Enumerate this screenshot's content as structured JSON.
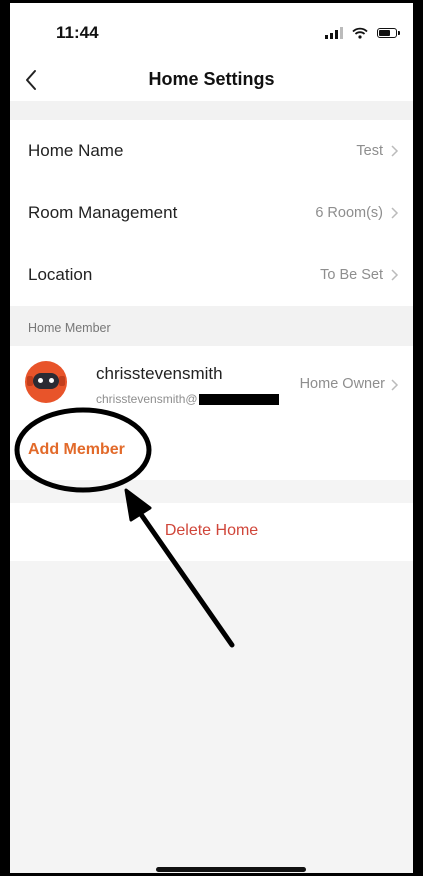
{
  "status_bar": {
    "time": "11:44"
  },
  "nav": {
    "title": "Home Settings"
  },
  "settings_rows": [
    {
      "label": "Home Name",
      "value": "Test"
    },
    {
      "label": "Room Management",
      "value": "6 Room(s)"
    },
    {
      "label": "Location",
      "value": "To Be Set"
    }
  ],
  "members_section": {
    "header": "Home Member",
    "members": [
      {
        "name": "chrisstevensmith",
        "email": "chrisstevensmith@",
        "role": "Home Owner"
      }
    ],
    "add_member_label": "Add Member"
  },
  "delete_label": "Delete Home",
  "colors": {
    "accent": "#e26a2a",
    "danger": "#d0463a",
    "avatar": "#e8542a"
  }
}
